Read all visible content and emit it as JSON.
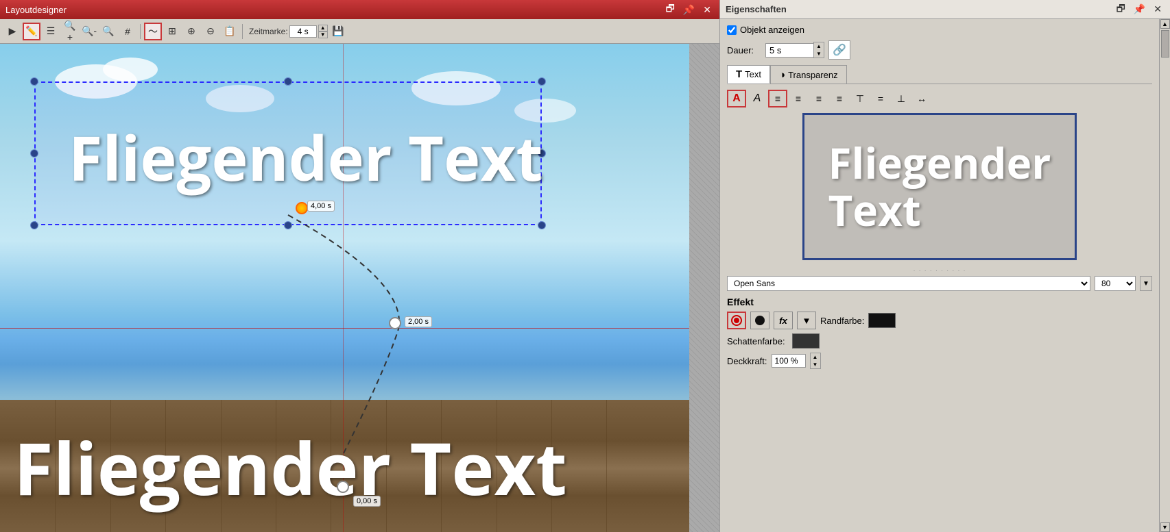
{
  "left": {
    "title": "Layoutdesigner",
    "toolbar": {
      "zeitmarke_label": "Zeitmarke:",
      "zeitmarke_value": "4 s"
    },
    "canvas": {
      "flying_text_top": "Fliegender Text",
      "flying_text_bottom": "Fliegender Text",
      "keyframe_4s": "4,00 s",
      "keyframe_2s": "2,00 s",
      "keyframe_0s": "0,00 s"
    }
  },
  "right": {
    "title": "Eigenschaften",
    "objekt_anzeigen": "Objekt anzeigen",
    "dauer_label": "Dauer:",
    "dauer_value": "5 s",
    "tabs": [
      {
        "label": "Text",
        "icon": "T"
      },
      {
        "label": "Transparenz",
        "icon": "◑"
      }
    ],
    "font_name": "Open Sans",
    "font_size": "80",
    "preview_text": "Fliegender\nText",
    "effekt": {
      "title": "Effekt",
      "randfarbe_label": "Randfarbe:",
      "schattenfarbe_label": "Schattenfarbe:",
      "deckkraft_label": "Deckkraft:",
      "deckkraft_value": "100 %"
    }
  }
}
